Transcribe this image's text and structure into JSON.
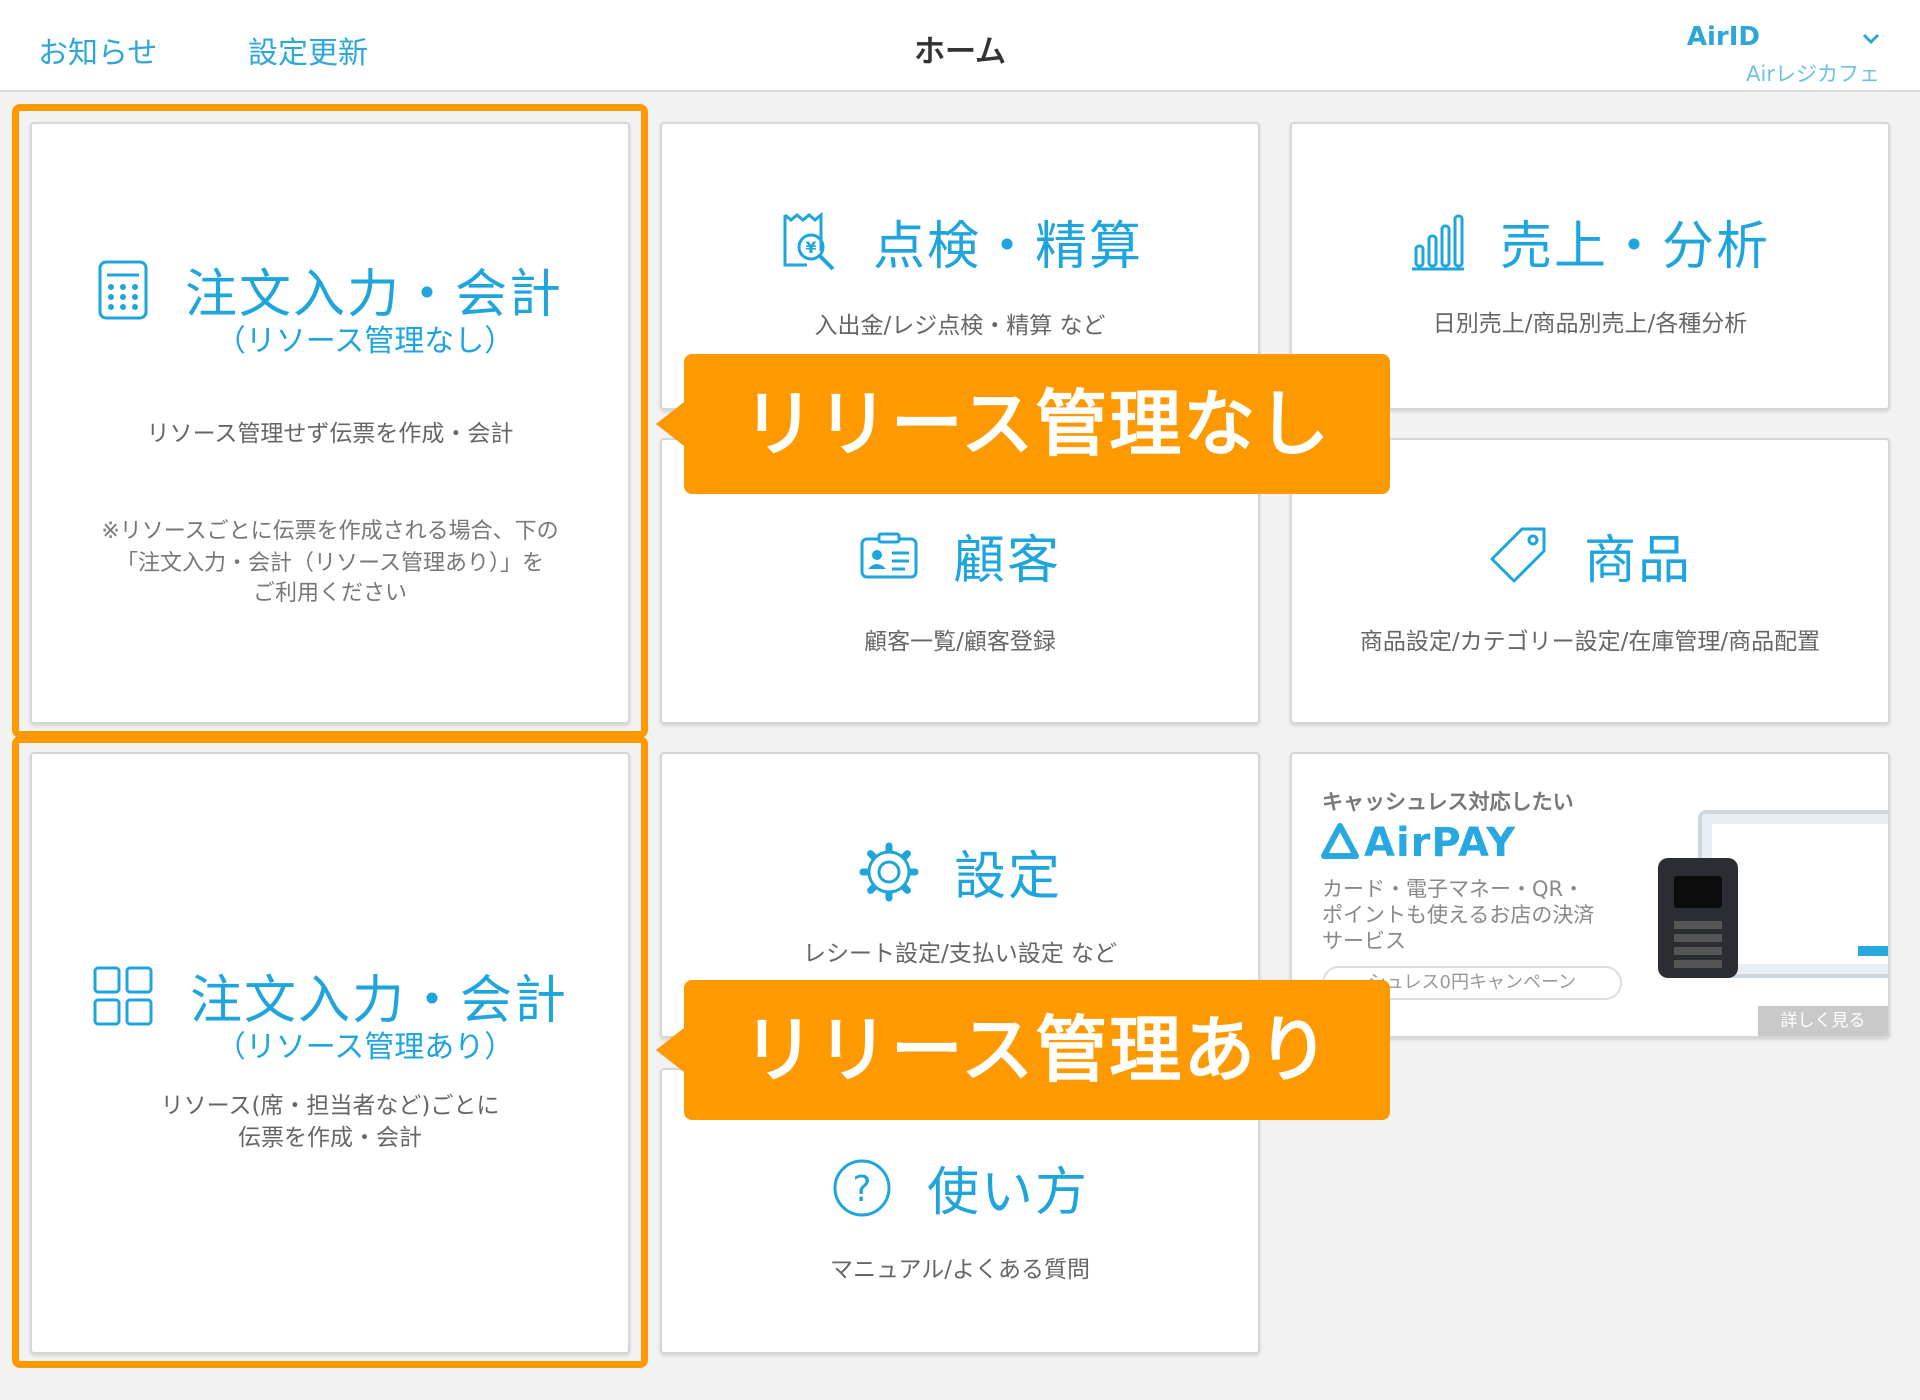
{
  "header": {
    "notices_label": "お知らせ",
    "settings_update_label": "設定更新",
    "title": "ホーム",
    "account_label": "AirID",
    "store_name": "Airレジカフェ"
  },
  "tiles": {
    "order_no_resource": {
      "title": "注文入力・会計",
      "subtitle": "（リソース管理なし）",
      "description": "リソース管理せず伝票を作成・会計",
      "note_line1": "※リソースごとに伝票を作成される場合、下の",
      "note_line2": "「注文入力・会計（リソース管理あり）」を",
      "note_line3": "ご利用ください"
    },
    "order_resource": {
      "title": "注文入力・会計",
      "subtitle": "（リソース管理あり）",
      "description_line1": "リソース(席・担当者など)ごとに",
      "description_line2": "伝票を作成・会計"
    },
    "checkout": {
      "title": "点検・精算",
      "description": "入出金/レジ点検・精算 など"
    },
    "sales": {
      "title": "売上・分析",
      "description": "日別売上/商品別売上/各種分析"
    },
    "customers": {
      "title": "顧客",
      "description": "顧客一覧/顧客登録"
    },
    "products": {
      "title": "商品",
      "description": "商品設定/カテゴリー設定/在庫管理/商品配置"
    },
    "settings": {
      "title": "設定",
      "description": "レシート設定/支払い設定 など"
    },
    "help": {
      "title": "使い方",
      "description": "マニュアル/よくある質問"
    }
  },
  "ad": {
    "lead": "キャッシュレス対応したい",
    "logo": "AirPAY",
    "desc_line1": "カード・電子マネー・QR・",
    "desc_line2": "ポイントも使えるお店の決済",
    "desc_line3": "サービス",
    "campaign": "シュレス0円キャンペーン",
    "more_label": "詳しく見る"
  },
  "callouts": {
    "no_resource": "リリース管理なし",
    "resource": "リリース管理あり"
  },
  "colors": {
    "accent": "#1ea5de",
    "highlight": "#ff9900"
  }
}
